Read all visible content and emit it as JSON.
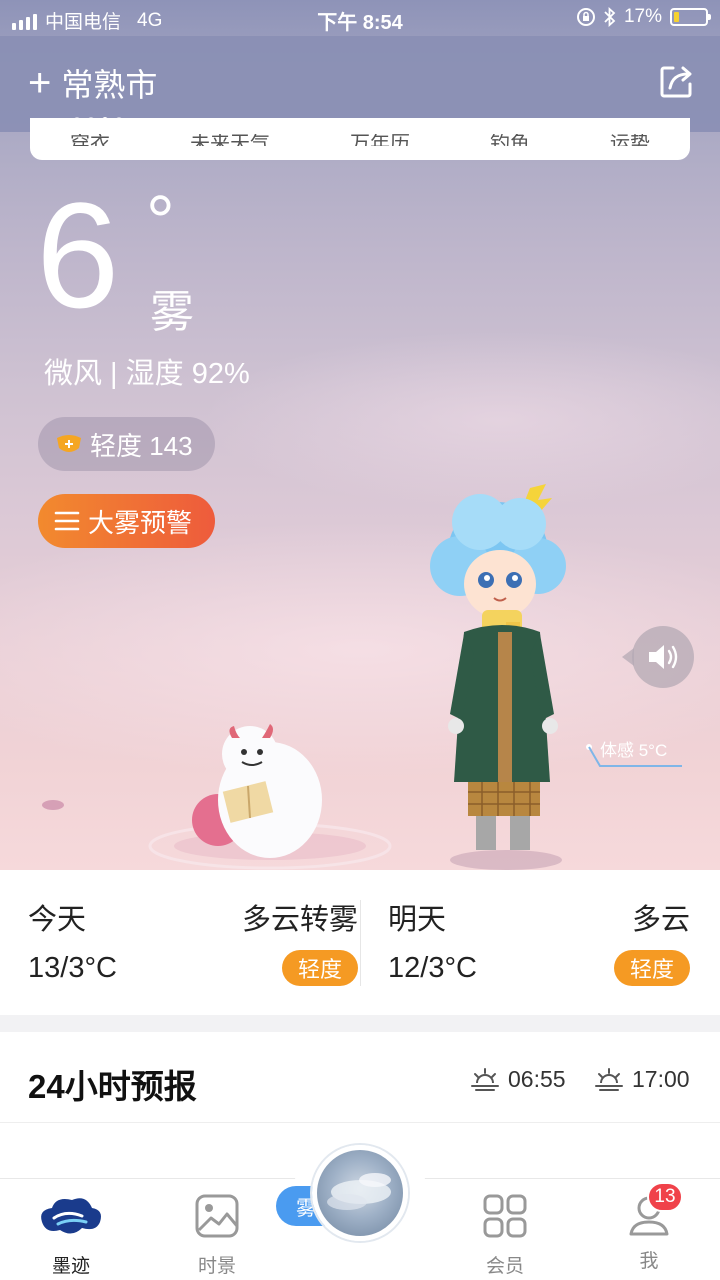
{
  "status_bar": {
    "carrier": "中国电信",
    "network": "4G",
    "time": "下午 8:54",
    "battery_percent": "17%",
    "battery_level": 0.17,
    "icons": [
      "signal-icon",
      "lock-rotation-icon",
      "bluetooth-icon",
      "battery-icon"
    ]
  },
  "header": {
    "city": "常熟市",
    "add_icon": "plus-icon",
    "share_icon": "share-icon",
    "page_count": 3,
    "active_page": 3
  },
  "tabs": [
    "穿衣",
    "未来天气",
    "万年历",
    "钓鱼",
    "运势"
  ],
  "current": {
    "temperature": "6",
    "degree_symbol": "°",
    "condition": "雾",
    "wind_humidity": "微风 | 湿度 92%",
    "aqi_label": "轻度 143",
    "warning_label": "大雾预警",
    "feels_like": "体感 5°C"
  },
  "forecast": {
    "today": {
      "day": "今天",
      "desc": "多云转雾",
      "range": "13/3°C",
      "aq": "轻度"
    },
    "tomorrow": {
      "day": "明天",
      "desc": "多云",
      "range": "12/3°C",
      "aq": "轻度"
    }
  },
  "hourly": {
    "title": "24小时预报",
    "sunrise": "06:55",
    "sunset": "17:00"
  },
  "nav": {
    "items": [
      {
        "label": "墨迹",
        "icon": "moji-cloud-icon",
        "active": true
      },
      {
        "label": "时景",
        "icon": "photo-icon",
        "active": false
      },
      {
        "label": "会员",
        "icon": "grid-icon",
        "active": false
      },
      {
        "label": "我",
        "icon": "profile-icon",
        "active": false,
        "badge": "13"
      }
    ],
    "center_tag": "雾"
  },
  "colors": {
    "accent_orange": "#f59a23",
    "warning_gradient_start": "#f28a2e",
    "warning_gradient_end": "#ee5b3c",
    "badge_red": "#f0424a"
  }
}
